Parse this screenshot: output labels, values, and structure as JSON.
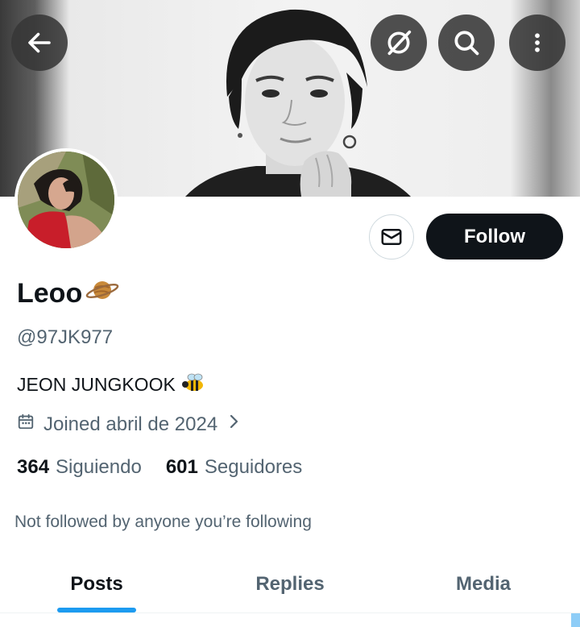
{
  "header": {
    "back_icon": "arrow-left-icon",
    "grok_icon": "grok-icon",
    "search_icon": "search-icon",
    "more_icon": "more-vertical-icon"
  },
  "profile": {
    "name": "Leoo",
    "name_emoji_icon": "ringed-planet-icon",
    "handle": "@97JK977",
    "bio": "JEON JUNGKOOK",
    "bio_emoji_icon": "bee-icon",
    "joined": "Joined abril de 2024",
    "following_count": "364",
    "following_label": "Siguiendo",
    "followers_count": "601",
    "followers_label": "Seguidores",
    "not_followed_text": "Not followed by anyone you’re following"
  },
  "actions": {
    "message_icon": "envelope-icon",
    "follow_label": "Follow"
  },
  "tabs": [
    {
      "label": "Posts",
      "active": true
    },
    {
      "label": "Replies",
      "active": false
    },
    {
      "label": "Media",
      "active": false
    }
  ],
  "colors": {
    "accent": "#1d9bf0",
    "primary_text": "#0f1419",
    "secondary_text": "#536471",
    "follow_button_bg": "#0f1419"
  }
}
